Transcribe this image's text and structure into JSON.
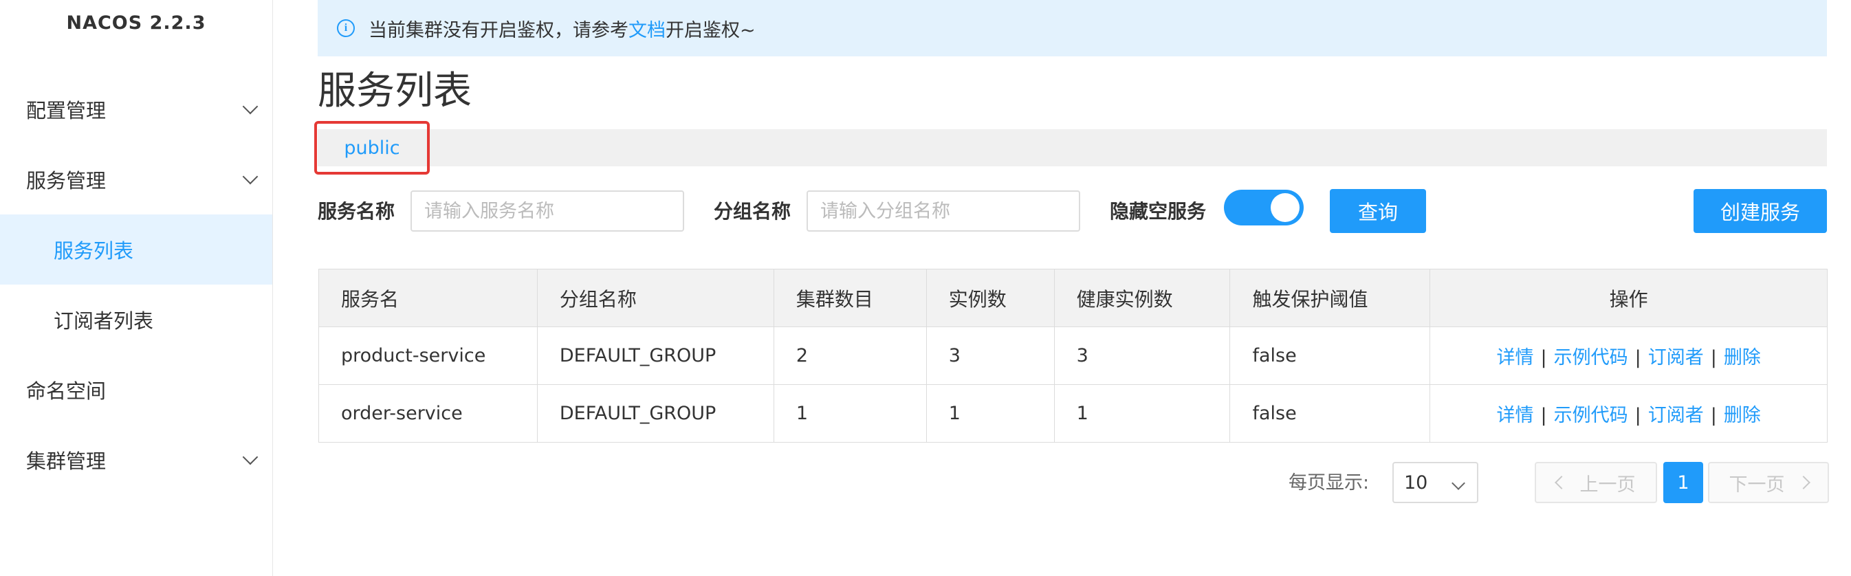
{
  "brand": "NACOS 2.2.3",
  "sidebar": {
    "items": [
      {
        "label": "配置管理",
        "expandable": true
      },
      {
        "label": "服务管理",
        "expandable": true
      },
      {
        "label": "服务列表",
        "active": true
      },
      {
        "label": "订阅者列表"
      },
      {
        "label": "命名空间"
      },
      {
        "label": "集群管理",
        "expandable": true
      }
    ]
  },
  "notice": {
    "icon": "info-icon",
    "text_before": "当前集群没有开启鉴权，请参考",
    "link": "文档",
    "text_after": "开启鉴权~"
  },
  "page": {
    "title": "服务列表"
  },
  "namespace": {
    "tab": "public"
  },
  "filters": {
    "service_name_label": "服务名称",
    "service_name_placeholder": "请输入服务名称",
    "group_name_label": "分组名称",
    "group_name_placeholder": "请输入分组名称",
    "hide_empty_label": "隐藏空服务",
    "hide_empty_on": true,
    "query_button": "查询",
    "create_button": "创建服务"
  },
  "table": {
    "headers": [
      "服务名",
      "分组名称",
      "集群数目",
      "实例数",
      "健康实例数",
      "触发保护阈值",
      "操作"
    ],
    "rows": [
      {
        "name": "product-service",
        "group": "DEFAULT_GROUP",
        "clusters": "2",
        "instances": "3",
        "healthy": "3",
        "threshold": "false"
      },
      {
        "name": "order-service",
        "group": "DEFAULT_GROUP",
        "clusters": "1",
        "instances": "1",
        "healthy": "1",
        "threshold": "false"
      }
    ],
    "actions": {
      "detail": "详情",
      "sample_code": "示例代码",
      "subscribers": "订阅者",
      "delete": "删除",
      "separator": "|"
    }
  },
  "pagination": {
    "page_size_label": "每页显示:",
    "page_size": "10",
    "prev": "上一页",
    "current": "1",
    "next": "下一页"
  },
  "colors": {
    "primary": "#209bfa",
    "notice_bg": "#e3f2fd",
    "highlight_border": "#e53935"
  }
}
